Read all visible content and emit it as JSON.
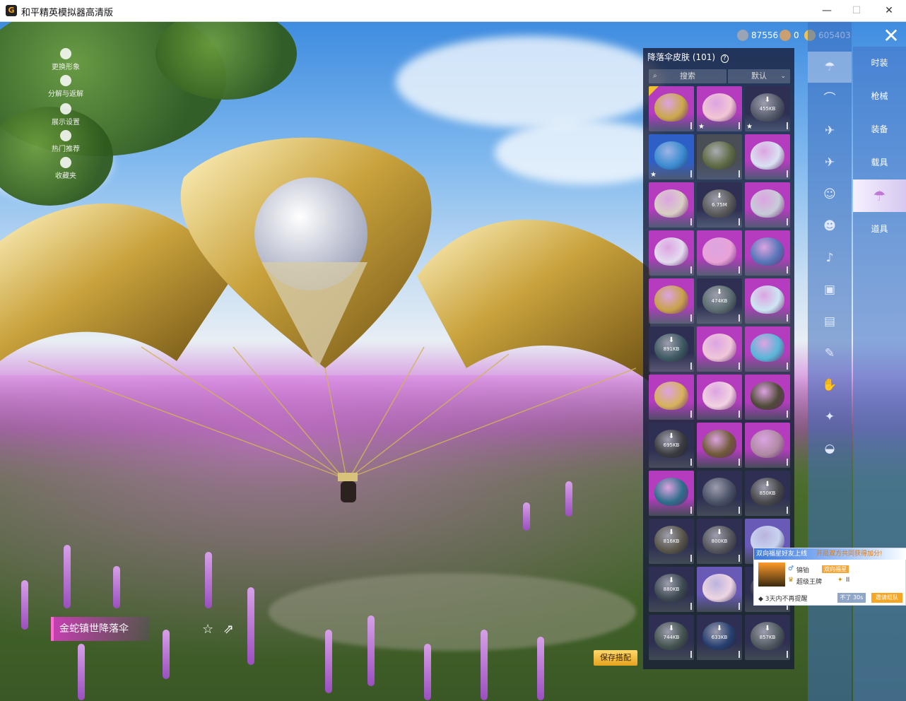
{
  "window": {
    "title": "和平精英模拟器高清版",
    "minimize": "—",
    "maximize": "☐",
    "close": "✕"
  },
  "left_menu": [
    {
      "label": "更换形象",
      "icon": "person-icon"
    },
    {
      "label": "分解与返解",
      "icon": "puzzle-icon"
    },
    {
      "label": "展示设置",
      "icon": "eye-icon"
    },
    {
      "label": "热门推荐",
      "icon": "flame-icon"
    },
    {
      "label": "收藏夹",
      "icon": "bookmark-icon"
    }
  ],
  "currency": [
    {
      "value": "87556",
      "icon": "silver-coin-icon",
      "color": "#9aa4b5"
    },
    {
      "value": "0",
      "icon": "bronze-coin-icon",
      "color": "#caa070"
    },
    {
      "value": "605403",
      "icon": "gold-coin-icon",
      "color": "#e8c25a"
    }
  ],
  "panel": {
    "title": "降落伞皮肤 (101)",
    "help": "?",
    "search_placeholder": "搜索",
    "sort_label": "默认"
  },
  "grid": [
    {
      "size": "",
      "bg": "#b53bbf",
      "orb": "#caa84a",
      "check": true
    },
    {
      "size": "",
      "bg": "#b53bbf",
      "orb": "#f2c6d4",
      "star": true
    },
    {
      "size": "455KB",
      "bg": "#2e2f52",
      "orb": "#545a6a",
      "dl": true,
      "star": true
    },
    {
      "size": "",
      "bg": "#2e5fc7",
      "orb": "#3c8cd0",
      "star": true
    },
    {
      "size": "",
      "bg": "#4a4e55",
      "orb": "#5d6a44"
    },
    {
      "size": "",
      "bg": "#b53bbf",
      "orb": "#d9e2f2"
    },
    {
      "size": "",
      "bg": "#b53bbf",
      "orb": "#d8cfc4"
    },
    {
      "size": "6.75M",
      "bg": "#2e2f52",
      "orb": "#5a5a5a",
      "dl": true
    },
    {
      "size": "",
      "bg": "#b53bbf",
      "orb": "#c7ccd8"
    },
    {
      "size": "",
      "bg": "#b53bbf",
      "orb": "#e4dbf0"
    },
    {
      "size": "",
      "bg": "#b53bbf",
      "orb": "#e9a3d8"
    },
    {
      "size": "",
      "bg": "#b53bbf",
      "orb": "#5576b8"
    },
    {
      "size": "",
      "bg": "#b53bbf",
      "orb": "#c9a24a"
    },
    {
      "size": "474KB",
      "bg": "#2e2f52",
      "orb": "#5c6d70",
      "dl": true
    },
    {
      "size": "",
      "bg": "#b53bbf",
      "orb": "#cde6f3"
    },
    {
      "size": "891KB",
      "bg": "#2e2f52",
      "orb": "#3e5a62",
      "dl": true
    },
    {
      "size": "",
      "bg": "#b53bbf",
      "orb": "#f0c7d9"
    },
    {
      "size": "",
      "bg": "#b53bbf",
      "orb": "#57b7d8"
    },
    {
      "size": "",
      "bg": "#b53bbf",
      "orb": "#d7b25a"
    },
    {
      "size": "",
      "bg": "#b53bbf",
      "orb": "#f2d2e2"
    },
    {
      "size": "",
      "bg": "#b53bbf",
      "orb": "#4e4a36"
    },
    {
      "size": "695KB",
      "bg": "#2e2f52",
      "orb": "#3b3b40",
      "dl": true
    },
    {
      "size": "",
      "bg": "#b53bbf",
      "orb": "#6f5a36"
    },
    {
      "size": "",
      "bg": "#b53bbf",
      "orb": "#b08aa4"
    },
    {
      "size": "",
      "bg": "#b53bbf",
      "orb": "#2d6d8a"
    },
    {
      "size": "",
      "bg": "#2e2f52",
      "orb": "#4a5268"
    },
    {
      "size": "850KB",
      "bg": "#2e2f52",
      "orb": "#48484c",
      "dl": true
    },
    {
      "size": "816KB",
      "bg": "#2e2f52",
      "orb": "#5a564a",
      "dl": true
    },
    {
      "size": "800KB",
      "bg": "#2e2f52",
      "orb": "#55565c",
      "dl": true
    },
    {
      "size": "",
      "bg": "#6a5ab8",
      "orb": "#c8d4f0"
    },
    {
      "size": "880KB",
      "bg": "#2e2f52",
      "orb": "#3e4a52",
      "dl": true
    },
    {
      "size": "",
      "bg": "#6a5ab8",
      "orb": "#eed6e2"
    },
    {
      "size": "",
      "bg": "#2e2f52",
      "orb": "#3a3a4a"
    },
    {
      "size": "744KB",
      "bg": "#2e2f52",
      "orb": "#455450",
      "dl": true
    },
    {
      "size": "633KB",
      "bg": "#2e2f52",
      "orb": "#274070",
      "dl": true
    },
    {
      "size": "857KB",
      "bg": "#2e2f52",
      "orb": "#505a60",
      "dl": true
    }
  ],
  "icon_column": [
    {
      "icon": "parachute-icon",
      "glyph": "☂",
      "active": true
    },
    {
      "icon": "hat-icon",
      "glyph": "⌒"
    },
    {
      "icon": "drone-icon",
      "glyph": "✈"
    },
    {
      "icon": "plane-icon",
      "glyph": "✈"
    },
    {
      "icon": "emote-icon",
      "glyph": "☺"
    },
    {
      "icon": "robot-icon",
      "glyph": "☻"
    },
    {
      "icon": "speaker-icon",
      "glyph": "♪"
    },
    {
      "icon": "face-icon",
      "glyph": "▣"
    },
    {
      "icon": "picture-icon",
      "glyph": "▤"
    },
    {
      "icon": "spray-icon",
      "glyph": "✎"
    },
    {
      "icon": "hand-icon",
      "glyph": "✋"
    },
    {
      "icon": "wand-icon",
      "glyph": "✦"
    },
    {
      "icon": "saucer-icon",
      "glyph": "◒"
    }
  ],
  "categories": [
    {
      "label": "时装"
    },
    {
      "label": "枪械"
    },
    {
      "label": "装备"
    },
    {
      "label": "载具"
    },
    {
      "label": "",
      "active": true
    },
    {
      "label": "道具"
    }
  ],
  "item": {
    "name": "金蛇镇世降落伞",
    "save_label": "保存搭配"
  },
  "popup": {
    "header": "双向福星好友上线",
    "note": "开局双方共同获得加分!",
    "player_name": "锦铂",
    "tag": "双向福星",
    "rank": "超级王牌",
    "rank_level": "II",
    "hint": "3天内不再提醒",
    "dismiss": "不了 30s",
    "invite": "邀请组队"
  }
}
